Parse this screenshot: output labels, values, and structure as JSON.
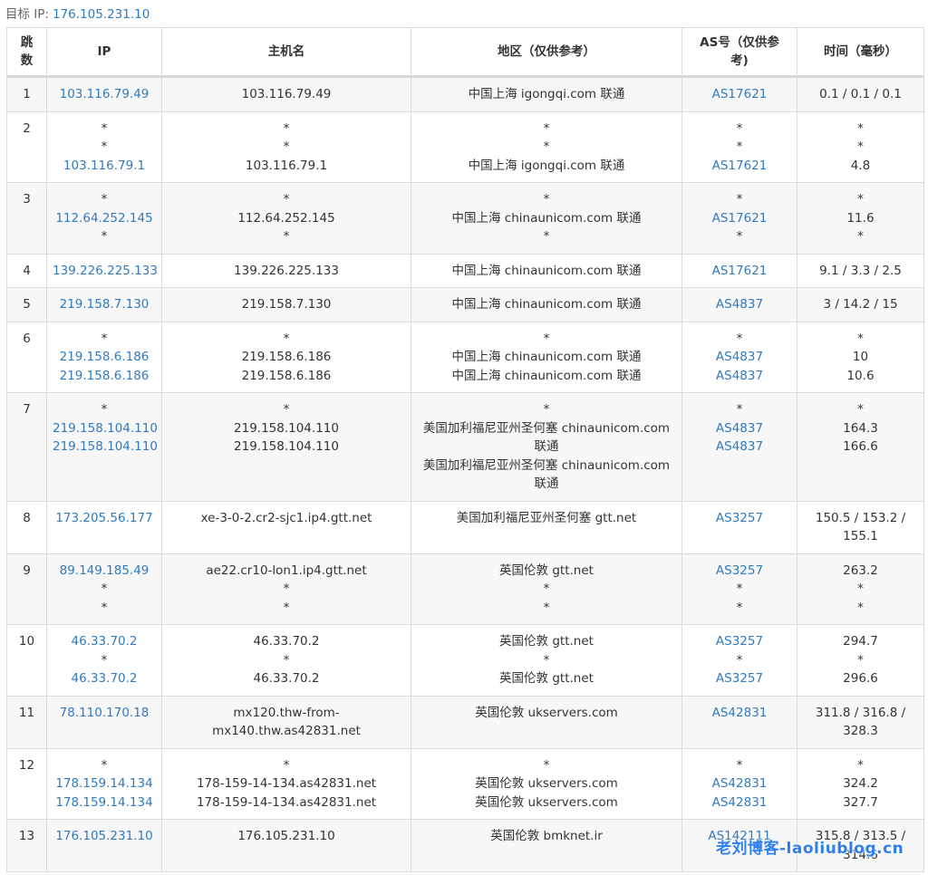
{
  "target": {
    "label": "目标 IP:",
    "ip": "176.105.231.10"
  },
  "headers": {
    "hop": "跳\n数",
    "ip": "IP",
    "host": "主机名",
    "region": "地区（仅供参考）",
    "as": "AS号（仅供参\n考)",
    "time": "时间（毫秒）"
  },
  "rows": [
    {
      "hop": "1",
      "ip": [
        "103.116.79.49"
      ],
      "host": [
        "103.116.79.49"
      ],
      "region": [
        "中国上海 igongqi.com 联通"
      ],
      "as": [
        "AS17621"
      ],
      "time": [
        "0.1 / 0.1 / 0.1"
      ]
    },
    {
      "hop": "2",
      "ip": [
        "*",
        "*",
        "103.116.79.1"
      ],
      "host": [
        "*",
        "*",
        "103.116.79.1"
      ],
      "region": [
        "*",
        "*",
        "中国上海 igongqi.com 联通"
      ],
      "as": [
        "*",
        "*",
        "AS17621"
      ],
      "time": [
        "*",
        "*",
        "4.8"
      ]
    },
    {
      "hop": "3",
      "ip": [
        "*",
        "112.64.252.145",
        "*"
      ],
      "host": [
        "*",
        "112.64.252.145",
        "*"
      ],
      "region": [
        "*",
        "中国上海 chinaunicom.com 联通",
        "*"
      ],
      "as": [
        "*",
        "AS17621",
        "*"
      ],
      "time": [
        "*",
        "11.6",
        "*"
      ]
    },
    {
      "hop": "4",
      "ip": [
        "139.226.225.133"
      ],
      "host": [
        "139.226.225.133"
      ],
      "region": [
        "中国上海 chinaunicom.com 联通"
      ],
      "as": [
        "AS17621"
      ],
      "time": [
        "9.1 / 3.3 / 2.5"
      ]
    },
    {
      "hop": "5",
      "ip": [
        "219.158.7.130"
      ],
      "host": [
        "219.158.7.130"
      ],
      "region": [
        "中国上海 chinaunicom.com 联通"
      ],
      "as": [
        "AS4837"
      ],
      "time": [
        "3 / 14.2 / 15"
      ]
    },
    {
      "hop": "6",
      "ip": [
        "*",
        "219.158.6.186",
        "219.158.6.186"
      ],
      "host": [
        "*",
        "219.158.6.186",
        "219.158.6.186"
      ],
      "region": [
        "*",
        "中国上海 chinaunicom.com 联通",
        "中国上海 chinaunicom.com 联通"
      ],
      "as": [
        "*",
        "AS4837",
        "AS4837"
      ],
      "time": [
        "*",
        "10",
        "10.6"
      ]
    },
    {
      "hop": "7",
      "ip": [
        "*",
        "219.158.104.110",
        "219.158.104.110"
      ],
      "host": [
        "*",
        "219.158.104.110",
        "219.158.104.110"
      ],
      "region": [
        "*",
        "美国加利福尼亚州圣何塞 chinaunicom.com 联通",
        "美国加利福尼亚州圣何塞 chinaunicom.com 联通"
      ],
      "as": [
        "*",
        "AS4837",
        "AS4837"
      ],
      "time": [
        "*",
        "164.3",
        "166.6"
      ]
    },
    {
      "hop": "8",
      "ip": [
        "173.205.56.177"
      ],
      "host": [
        "xe-3-0-2.cr2-sjc1.ip4.gtt.net"
      ],
      "region": [
        "美国加利福尼亚州圣何塞 gtt.net"
      ],
      "as": [
        "AS3257"
      ],
      "time": [
        "150.5 / 153.2 / 155.1"
      ]
    },
    {
      "hop": "9",
      "ip": [
        "89.149.185.49",
        "*",
        "*"
      ],
      "host": [
        "ae22.cr10-lon1.ip4.gtt.net",
        "*",
        "*"
      ],
      "region": [
        "英国伦敦 gtt.net",
        "*",
        "*"
      ],
      "as": [
        "AS3257",
        "*",
        "*"
      ],
      "time": [
        "263.2",
        "*",
        "*"
      ]
    },
    {
      "hop": "10",
      "ip": [
        "46.33.70.2",
        "*",
        "46.33.70.2"
      ],
      "host": [
        "46.33.70.2",
        "*",
        "46.33.70.2"
      ],
      "region": [
        "英国伦敦 gtt.net",
        "*",
        "英国伦敦 gtt.net"
      ],
      "as": [
        "AS3257",
        "*",
        "AS3257"
      ],
      "time": [
        "294.7",
        "*",
        "296.6"
      ]
    },
    {
      "hop": "11",
      "ip": [
        "78.110.170.18"
      ],
      "host": [
        "mx120.thw-from-mx140.thw.as42831.net"
      ],
      "region": [
        "英国伦敦 ukservers.com"
      ],
      "as": [
        "AS42831"
      ],
      "time": [
        "311.8 / 316.8 / 328.3"
      ]
    },
    {
      "hop": "12",
      "ip": [
        "*",
        "178.159.14.134",
        "178.159.14.134"
      ],
      "host": [
        "*",
        "178-159-14-134.as42831.net",
        "178-159-14-134.as42831.net"
      ],
      "region": [
        "*",
        "英国伦敦 ukservers.com",
        "英国伦敦 ukservers.com"
      ],
      "as": [
        "*",
        "AS42831",
        "AS42831"
      ],
      "time": [
        "*",
        "324.2",
        "327.7"
      ]
    },
    {
      "hop": "13",
      "ip": [
        "176.105.231.10"
      ],
      "host": [
        "176.105.231.10"
      ],
      "region": [
        "英国伦敦 bmknet.ir"
      ],
      "as": [
        "AS142111"
      ],
      "time": [
        "315.8 / 313.5 / 314.6"
      ]
    }
  ],
  "watermark": "老刘博客-laoliublog.cn",
  "colors": {
    "link": "#2f7ac0",
    "stripe": "#f7f7f7",
    "border": "#dcdcdc"
  }
}
